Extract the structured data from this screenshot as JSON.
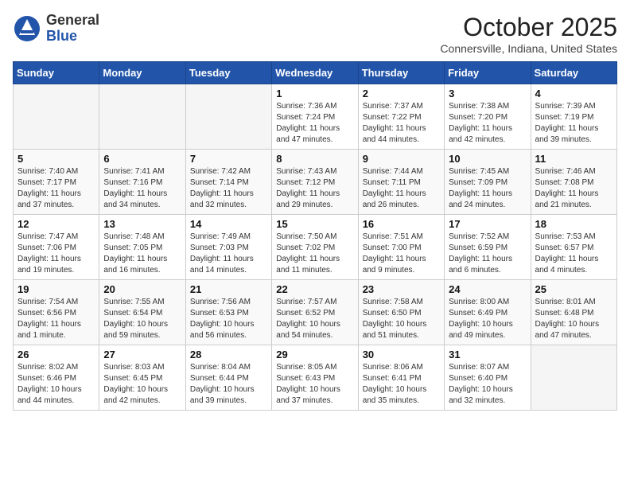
{
  "header": {
    "logo": {
      "general": "General",
      "blue": "Blue"
    },
    "month": "October 2025",
    "location": "Connersville, Indiana, United States"
  },
  "calendar": {
    "days_of_week": [
      "Sunday",
      "Monday",
      "Tuesday",
      "Wednesday",
      "Thursday",
      "Friday",
      "Saturday"
    ],
    "weeks": [
      [
        {
          "day": "",
          "sunrise": "",
          "sunset": "",
          "daylight": ""
        },
        {
          "day": "",
          "sunrise": "",
          "sunset": "",
          "daylight": ""
        },
        {
          "day": "",
          "sunrise": "",
          "sunset": "",
          "daylight": ""
        },
        {
          "day": "1",
          "sunrise": "Sunrise: 7:36 AM",
          "sunset": "Sunset: 7:24 PM",
          "daylight": "Daylight: 11 hours and 47 minutes."
        },
        {
          "day": "2",
          "sunrise": "Sunrise: 7:37 AM",
          "sunset": "Sunset: 7:22 PM",
          "daylight": "Daylight: 11 hours and 44 minutes."
        },
        {
          "day": "3",
          "sunrise": "Sunrise: 7:38 AM",
          "sunset": "Sunset: 7:20 PM",
          "daylight": "Daylight: 11 hours and 42 minutes."
        },
        {
          "day": "4",
          "sunrise": "Sunrise: 7:39 AM",
          "sunset": "Sunset: 7:19 PM",
          "daylight": "Daylight: 11 hours and 39 minutes."
        }
      ],
      [
        {
          "day": "5",
          "sunrise": "Sunrise: 7:40 AM",
          "sunset": "Sunset: 7:17 PM",
          "daylight": "Daylight: 11 hours and 37 minutes."
        },
        {
          "day": "6",
          "sunrise": "Sunrise: 7:41 AM",
          "sunset": "Sunset: 7:16 PM",
          "daylight": "Daylight: 11 hours and 34 minutes."
        },
        {
          "day": "7",
          "sunrise": "Sunrise: 7:42 AM",
          "sunset": "Sunset: 7:14 PM",
          "daylight": "Daylight: 11 hours and 32 minutes."
        },
        {
          "day": "8",
          "sunrise": "Sunrise: 7:43 AM",
          "sunset": "Sunset: 7:12 PM",
          "daylight": "Daylight: 11 hours and 29 minutes."
        },
        {
          "day": "9",
          "sunrise": "Sunrise: 7:44 AM",
          "sunset": "Sunset: 7:11 PM",
          "daylight": "Daylight: 11 hours and 26 minutes."
        },
        {
          "day": "10",
          "sunrise": "Sunrise: 7:45 AM",
          "sunset": "Sunset: 7:09 PM",
          "daylight": "Daylight: 11 hours and 24 minutes."
        },
        {
          "day": "11",
          "sunrise": "Sunrise: 7:46 AM",
          "sunset": "Sunset: 7:08 PM",
          "daylight": "Daylight: 11 hours and 21 minutes."
        }
      ],
      [
        {
          "day": "12",
          "sunrise": "Sunrise: 7:47 AM",
          "sunset": "Sunset: 7:06 PM",
          "daylight": "Daylight: 11 hours and 19 minutes."
        },
        {
          "day": "13",
          "sunrise": "Sunrise: 7:48 AM",
          "sunset": "Sunset: 7:05 PM",
          "daylight": "Daylight: 11 hours and 16 minutes."
        },
        {
          "day": "14",
          "sunrise": "Sunrise: 7:49 AM",
          "sunset": "Sunset: 7:03 PM",
          "daylight": "Daylight: 11 hours and 14 minutes."
        },
        {
          "day": "15",
          "sunrise": "Sunrise: 7:50 AM",
          "sunset": "Sunset: 7:02 PM",
          "daylight": "Daylight: 11 hours and 11 minutes."
        },
        {
          "day": "16",
          "sunrise": "Sunrise: 7:51 AM",
          "sunset": "Sunset: 7:00 PM",
          "daylight": "Daylight: 11 hours and 9 minutes."
        },
        {
          "day": "17",
          "sunrise": "Sunrise: 7:52 AM",
          "sunset": "Sunset: 6:59 PM",
          "daylight": "Daylight: 11 hours and 6 minutes."
        },
        {
          "day": "18",
          "sunrise": "Sunrise: 7:53 AM",
          "sunset": "Sunset: 6:57 PM",
          "daylight": "Daylight: 11 hours and 4 minutes."
        }
      ],
      [
        {
          "day": "19",
          "sunrise": "Sunrise: 7:54 AM",
          "sunset": "Sunset: 6:56 PM",
          "daylight": "Daylight: 11 hours and 1 minute."
        },
        {
          "day": "20",
          "sunrise": "Sunrise: 7:55 AM",
          "sunset": "Sunset: 6:54 PM",
          "daylight": "Daylight: 10 hours and 59 minutes."
        },
        {
          "day": "21",
          "sunrise": "Sunrise: 7:56 AM",
          "sunset": "Sunset: 6:53 PM",
          "daylight": "Daylight: 10 hours and 56 minutes."
        },
        {
          "day": "22",
          "sunrise": "Sunrise: 7:57 AM",
          "sunset": "Sunset: 6:52 PM",
          "daylight": "Daylight: 10 hours and 54 minutes."
        },
        {
          "day": "23",
          "sunrise": "Sunrise: 7:58 AM",
          "sunset": "Sunset: 6:50 PM",
          "daylight": "Daylight: 10 hours and 51 minutes."
        },
        {
          "day": "24",
          "sunrise": "Sunrise: 8:00 AM",
          "sunset": "Sunset: 6:49 PM",
          "daylight": "Daylight: 10 hours and 49 minutes."
        },
        {
          "day": "25",
          "sunrise": "Sunrise: 8:01 AM",
          "sunset": "Sunset: 6:48 PM",
          "daylight": "Daylight: 10 hours and 47 minutes."
        }
      ],
      [
        {
          "day": "26",
          "sunrise": "Sunrise: 8:02 AM",
          "sunset": "Sunset: 6:46 PM",
          "daylight": "Daylight: 10 hours and 44 minutes."
        },
        {
          "day": "27",
          "sunrise": "Sunrise: 8:03 AM",
          "sunset": "Sunset: 6:45 PM",
          "daylight": "Daylight: 10 hours and 42 minutes."
        },
        {
          "day": "28",
          "sunrise": "Sunrise: 8:04 AM",
          "sunset": "Sunset: 6:44 PM",
          "daylight": "Daylight: 10 hours and 39 minutes."
        },
        {
          "day": "29",
          "sunrise": "Sunrise: 8:05 AM",
          "sunset": "Sunset: 6:43 PM",
          "daylight": "Daylight: 10 hours and 37 minutes."
        },
        {
          "day": "30",
          "sunrise": "Sunrise: 8:06 AM",
          "sunset": "Sunset: 6:41 PM",
          "daylight": "Daylight: 10 hours and 35 minutes."
        },
        {
          "day": "31",
          "sunrise": "Sunrise: 8:07 AM",
          "sunset": "Sunset: 6:40 PM",
          "daylight": "Daylight: 10 hours and 32 minutes."
        },
        {
          "day": "",
          "sunrise": "",
          "sunset": "",
          "daylight": ""
        }
      ]
    ]
  }
}
